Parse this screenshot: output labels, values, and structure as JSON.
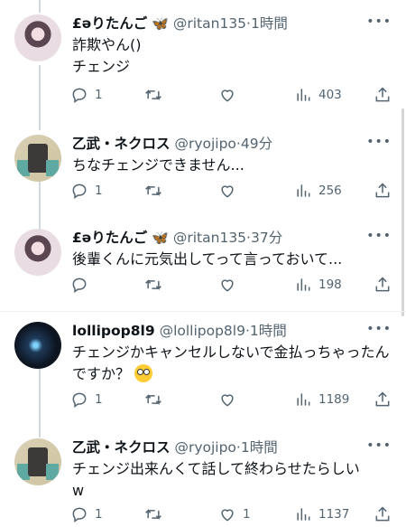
{
  "tweets": [
    {
      "name": "£ǝりたんご",
      "butterfly": "🦋",
      "handle": "@ritan135",
      "time": "1時間",
      "text": "詐欺やん()\nチェンジ",
      "replies": "1",
      "retweets": "",
      "likes": "",
      "views": "403",
      "avatar": "girl"
    },
    {
      "name": "乙武・ネクロス",
      "butterfly": "",
      "handle": "@ryojipo",
      "time": "49分",
      "text": "ちなチェンジできません...",
      "replies": "1",
      "retweets": "",
      "likes": "",
      "views": "256",
      "avatar": "robot"
    },
    {
      "name": "£ǝりたんご",
      "butterfly": "🦋",
      "handle": "@ritan135",
      "time": "37分",
      "text": "後輩くんに元気出してって言っておいて...",
      "replies": "",
      "retweets": "",
      "likes": "",
      "views": "198",
      "avatar": "girl"
    },
    {
      "name": "lollipop8l9",
      "butterfly": "",
      "handle": "@lollipop8l9",
      "time": "1時間",
      "text": "チェンジかキャンセルしないで金払っちゃったんですか？",
      "replies": "1",
      "retweets": "",
      "likes": "",
      "views": "1189",
      "avatar": "orb"
    },
    {
      "name": "乙武・ネクロス",
      "butterfly": "",
      "handle": "@ryojipo",
      "time": "1時間",
      "text": "チェンジ出来んくて話して終わらせたらしい\nw",
      "replies": "1",
      "retweets": "",
      "likes": "1",
      "views": "1137",
      "avatar": "robot"
    }
  ],
  "icons": {
    "reply": "reply-icon",
    "retweet": "retweet-icon",
    "like": "heart-icon",
    "views": "views-icon",
    "share": "share-icon",
    "more": "more-icon",
    "emoji": "flushed-face-emoji"
  },
  "colors": {
    "text": "#0f1419",
    "meta": "#536471",
    "divider": "#eff3f4",
    "thread_line": "#cfd9de",
    "butterfly": "#3a8ff5"
  }
}
